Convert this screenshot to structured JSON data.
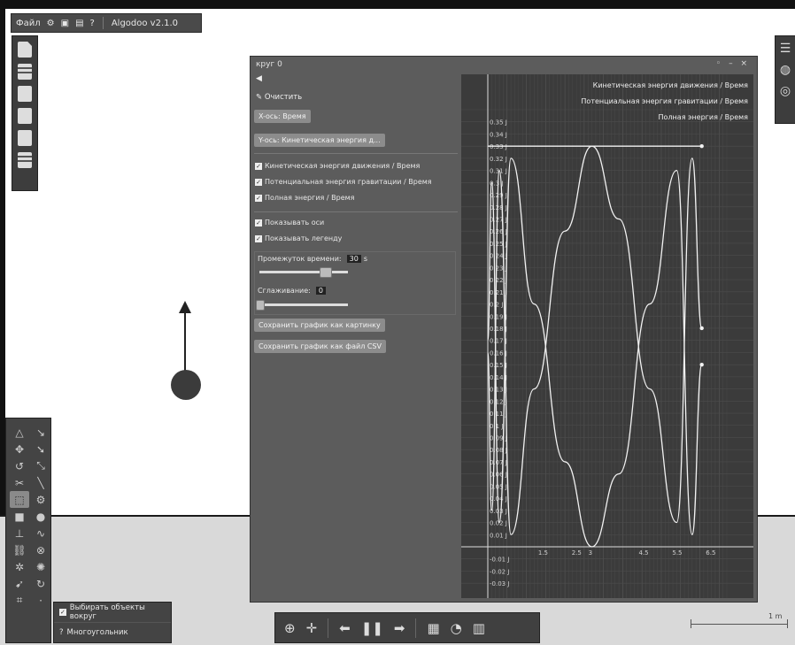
{
  "menubar": {
    "file": "Файл",
    "app_title": "Algodoo v2.1.0"
  },
  "graph_window": {
    "title": "круг 0",
    "clear": "Очистить",
    "x_axis_button": "X-ось: Время",
    "y_axis_button": "Y-ось: Кинетическая энергия д...",
    "checks": [
      {
        "label": "Кинетическая энергия движения / Время",
        "checked": true
      },
      {
        "label": "Потенциальная энергия гравитации / Время",
        "checked": true
      },
      {
        "label": "Полная энергия / Время",
        "checked": true
      }
    ],
    "show_axes": "Показывать оси",
    "show_legend": "Показывать легенду",
    "time_span_label": "Промежуток времени:",
    "time_span_value": "30",
    "time_span_unit": "s",
    "smoothing_label": "Сглаживание:",
    "smoothing_value": "0",
    "save_image": "Сохранить график как картинку",
    "save_csv": "Сохранить график как файл CSV"
  },
  "popmenu": {
    "item1": "Выбирать объекты вокруг",
    "item2": "Многоугольник"
  },
  "scale_label": "1 m",
  "chart_data": {
    "type": "line",
    "x": [
      0,
      0.25,
      0.55,
      0.9,
      1.5,
      2.0,
      2.5,
      2.9,
      3.5,
      4.0,
      4.5,
      4.9,
      5.2,
      5.6
    ],
    "xticks": [
      "1.5",
      "2.5",
      "3",
      "4.5",
      "5.5",
      "6.5"
    ],
    "yticks": [
      "0.35 J",
      "0.34 J",
      "0.33 J",
      "0.32 J",
      "0.31 J",
      "0.3 J",
      "0.29 J",
      "0.28 J",
      "0.27 J",
      "0.26 J",
      "0.25 J",
      "0.24 J",
      "0.23 J",
      "0.22 J",
      "0.21 J",
      "0.2 J",
      "0.19 J",
      "0.18 J",
      "0.17 J",
      "0.16 J",
      "0.15 J",
      "0.14 J",
      "0.13 J",
      "0.12 J",
      "0.11 J",
      "0.1 J",
      "0.09 J",
      "0.08 J",
      "0.07 J",
      "0.06 J",
      "0.05 J",
      "0.04 J",
      "0.03 J",
      "0.02 J",
      "0.01 J",
      "-0.01 J",
      "-0.02 J",
      "-0.03 J"
    ],
    "ylim": [
      -0.035,
      0.36
    ],
    "series": [
      {
        "name": "Кинетическая энергия движения / Время",
        "points": [
          [
            0,
            0.16
          ],
          [
            0.1,
            0.03
          ],
          [
            0.3,
            0.31
          ],
          [
            0.6,
            0.01
          ],
          [
            1.2,
            0.13
          ],
          [
            2.0,
            0.26
          ],
          [
            2.7,
            0.33
          ],
          [
            3.4,
            0.27
          ],
          [
            4.2,
            0.13
          ],
          [
            4.9,
            0.02
          ],
          [
            5.3,
            0.32
          ],
          [
            5.55,
            0.18
          ]
        ]
      },
      {
        "name": "Потенциальная энергия гравитации / Время",
        "points": [
          [
            0,
            0.17
          ],
          [
            0.1,
            0.3
          ],
          [
            0.3,
            0.02
          ],
          [
            0.6,
            0.32
          ],
          [
            1.2,
            0.2
          ],
          [
            2.0,
            0.07
          ],
          [
            2.7,
            0.0
          ],
          [
            3.4,
            0.06
          ],
          [
            4.2,
            0.2
          ],
          [
            4.9,
            0.31
          ],
          [
            5.3,
            0.01
          ],
          [
            5.55,
            0.15
          ]
        ]
      },
      {
        "name": "Полная энергия / Время",
        "points": [
          [
            0,
            0.33
          ],
          [
            5.55,
            0.33
          ]
        ]
      }
    ],
    "grid": true,
    "legend_position": "top-right"
  }
}
